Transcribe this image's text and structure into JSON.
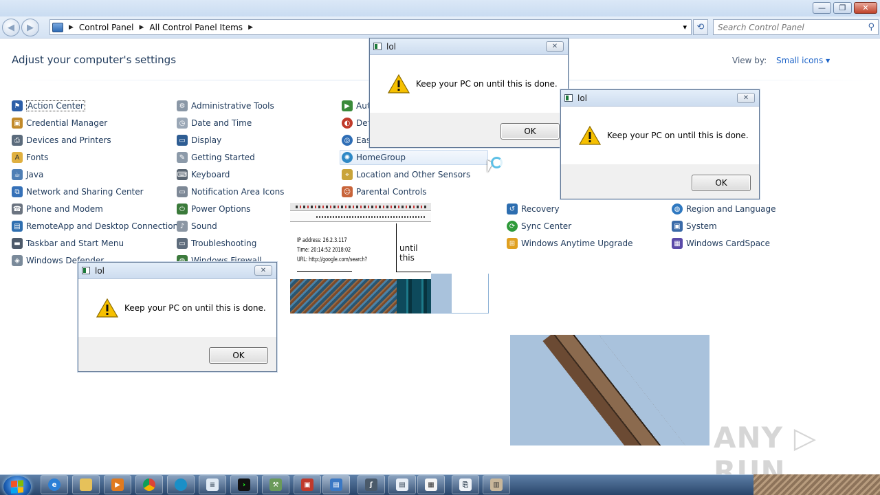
{
  "window": {
    "minimize_glyph": "—",
    "restore_glyph": "❐",
    "close_glyph": "✕"
  },
  "nav": {
    "back_glyph": "◀",
    "forward_glyph": "▶",
    "breadcrumb": [
      "Control Panel",
      "All Control Panel Items"
    ],
    "dropdown_glyph": "▾",
    "refresh_glyph": "⟲",
    "search_placeholder": "Search Control Panel",
    "search_icon": "search-icon"
  },
  "header": {
    "title": "Adjust your computer's settings",
    "view_by_label": "View by:",
    "view_by_value": "Small icons ▾"
  },
  "items": {
    "col1": [
      "Action Center",
      "Credential Manager",
      "Devices and Printers",
      "Fonts",
      "Java",
      "Network and Sharing Center",
      "Phone and Modem",
      "RemoteApp and Desktop Connections",
      "Taskbar and Start Menu",
      "Windows Defender"
    ],
    "col2": [
      "Administrative Tools",
      "Date and Time",
      "Display",
      "Getting Started",
      "Keyboard",
      "Notification Area Icons",
      "Power Options",
      "Sound",
      "Troubleshooting",
      "Windows Firewall"
    ],
    "col3": [
      "Aut",
      "Defa",
      "Ease",
      "HomeGroup",
      "Location and Other Sensors",
      "Parental Controls"
    ],
    "col4": [
      "Recovery",
      "Sync Center",
      "Windows Anytime Upgrade"
    ],
    "col5": [
      "Region and Language",
      "System",
      "Windows CardSpace"
    ]
  },
  "dialog": {
    "title": "lol",
    "message": "Keep your PC on until this is done.",
    "ok_label": "OK",
    "close_glyph": "✕"
  },
  "artifact": {
    "line1": "IP address: 26.2.3.117",
    "line2": "Time: 20:14:52 2018:02",
    "line3": "URL: http://google.com/search?",
    "until_text": "until this"
  },
  "taskbar": {
    "apps": [
      "ie-icon",
      "explorer-icon",
      "media-player-icon",
      "chrome-icon",
      "edge-icon",
      "notepad-icon",
      "cmd-icon",
      "tools-icon",
      "toolbox-icon",
      "control-panel-icon",
      "hook-icon",
      "document-icon",
      "calendar-icon",
      "file-icon",
      "archive-icon"
    ]
  },
  "watermark": "ANY ▷ RUN",
  "colors": {
    "link_blue": "#1e395b",
    "accent_blue": "#1e64c8",
    "warning_yellow": "#f6c000",
    "taskbar_top": "#5d7fa7"
  }
}
